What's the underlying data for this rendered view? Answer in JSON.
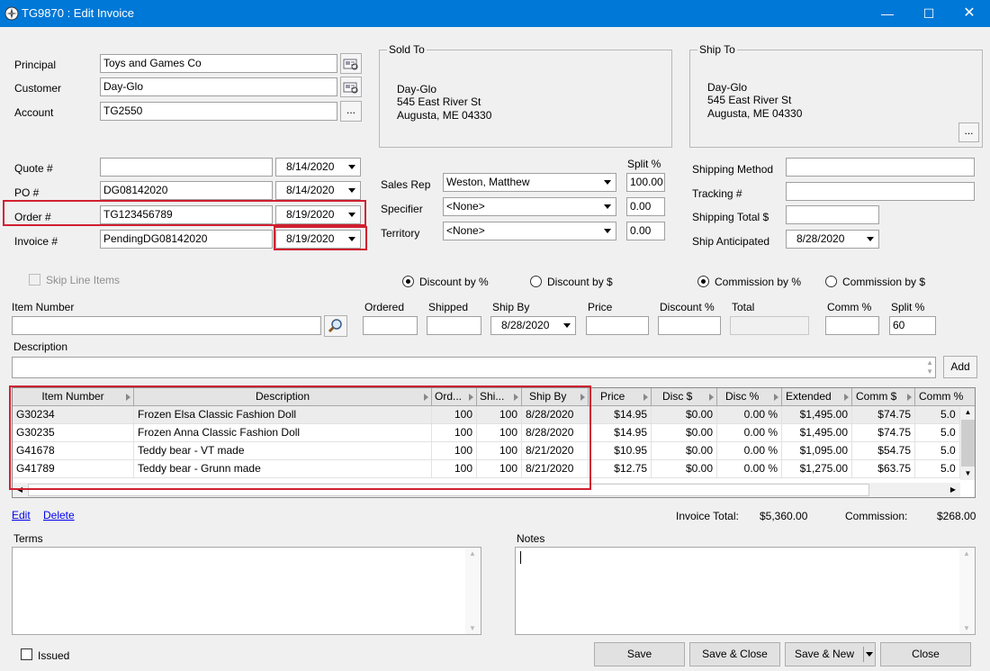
{
  "window": {
    "title": "TG9870 : Edit Invoice"
  },
  "header": {
    "principal": {
      "label": "Principal",
      "value": "Toys and Games Co"
    },
    "customer": {
      "label": "Customer",
      "value": "Day-Glo"
    },
    "account": {
      "label": "Account",
      "value": "TG2550",
      "browse": "..."
    }
  },
  "sold_to": {
    "legend": "Sold To",
    "line1": "Day-Glo",
    "line2": "545 East River St",
    "line3": "Augusta, ME 04330"
  },
  "ship_to": {
    "legend": "Ship To",
    "line1": "Day-Glo",
    "line2": "545 East River St",
    "line3": "Augusta, ME 04330",
    "browse": "..."
  },
  "docs": {
    "quote": {
      "label": "Quote #",
      "value": "",
      "date": "8/14/2020"
    },
    "po": {
      "label": "PO #",
      "value": "DG08142020",
      "date": "8/14/2020"
    },
    "order": {
      "label": "Order #",
      "value": "TG123456789",
      "date": "8/19/2020"
    },
    "invoice": {
      "label": "Invoice #",
      "value": "PendingDG08142020",
      "date": "8/19/2020"
    }
  },
  "sales": {
    "split_header": "Split %",
    "sales_rep": {
      "label": "Sales Rep",
      "value": "Weston, Matthew",
      "split": "100.00"
    },
    "specifier": {
      "label": "Specifier",
      "value": "<None>",
      "split": "0.00"
    },
    "territory": {
      "label": "Territory",
      "value": "<None>",
      "split": "0.00"
    }
  },
  "shipping": {
    "method": {
      "label": "Shipping Method",
      "value": ""
    },
    "tracking": {
      "label": "Tracking #",
      "value": ""
    },
    "total": {
      "label": "Shipping Total $",
      "value": ""
    },
    "anticipated": {
      "label": "Ship Anticipated",
      "value": "8/28/2020"
    }
  },
  "options": {
    "skip_line_items": "Skip Line Items",
    "discount_pct": "Discount by %",
    "discount_amt": "Discount by $",
    "commission_pct": "Commission by %",
    "commission_amt": "Commission by $"
  },
  "entry": {
    "item_number": "Item Number",
    "ordered": "Ordered",
    "shipped": "Shipped",
    "ship_by": "Ship By",
    "ship_by_value": "8/28/2020",
    "price": "Price",
    "discount_pct": "Discount %",
    "total": "Total",
    "comm_pct": "Comm %",
    "split_pct": "Split %",
    "split_value": "60",
    "description": "Description",
    "add": "Add"
  },
  "grid": {
    "columns": [
      "Item Number",
      "Description",
      "Ord...",
      "Shi...",
      "Ship By",
      "Price",
      "Disc $",
      "Disc %",
      "Extended",
      "Comm $",
      "Comm %"
    ],
    "rows": [
      [
        "G30234",
        "Frozen Elsa Classic Fashion Doll",
        "100",
        "100",
        "8/28/2020",
        "$14.95",
        "$0.00",
        "0.00 %",
        "$1,495.00",
        "$74.75",
        "5.0"
      ],
      [
        "G30235",
        "Frozen Anna Classic Fashion Doll",
        "100",
        "100",
        "8/28/2020",
        "$14.95",
        "$0.00",
        "0.00 %",
        "$1,495.00",
        "$74.75",
        "5.0"
      ],
      [
        "G41678",
        "Teddy bear - VT made",
        "100",
        "100",
        "8/21/2020",
        "$10.95",
        "$0.00",
        "0.00 %",
        "$1,095.00",
        "$54.75",
        "5.0"
      ],
      [
        "G41789",
        "Teddy bear - Grunn made",
        "100",
        "100",
        "8/21/2020",
        "$12.75",
        "$0.00",
        "0.00 %",
        "$1,275.00",
        "$63.75",
        "5.0"
      ]
    ]
  },
  "footer": {
    "edit": "Edit",
    "delete": "Delete",
    "invoice_total_label": "Invoice Total:",
    "invoice_total": "$5,360.00",
    "commission_label": "Commission:",
    "commission": "$268.00",
    "terms": "Terms",
    "notes": "Notes",
    "issued": "Issued",
    "save": "Save",
    "save_close": "Save & Close",
    "save_new": "Save & New",
    "close": "Close"
  },
  "colors": {
    "titlebar": "#0078d7",
    "highlight_box": "#d02030",
    "link": "#0000ee"
  }
}
